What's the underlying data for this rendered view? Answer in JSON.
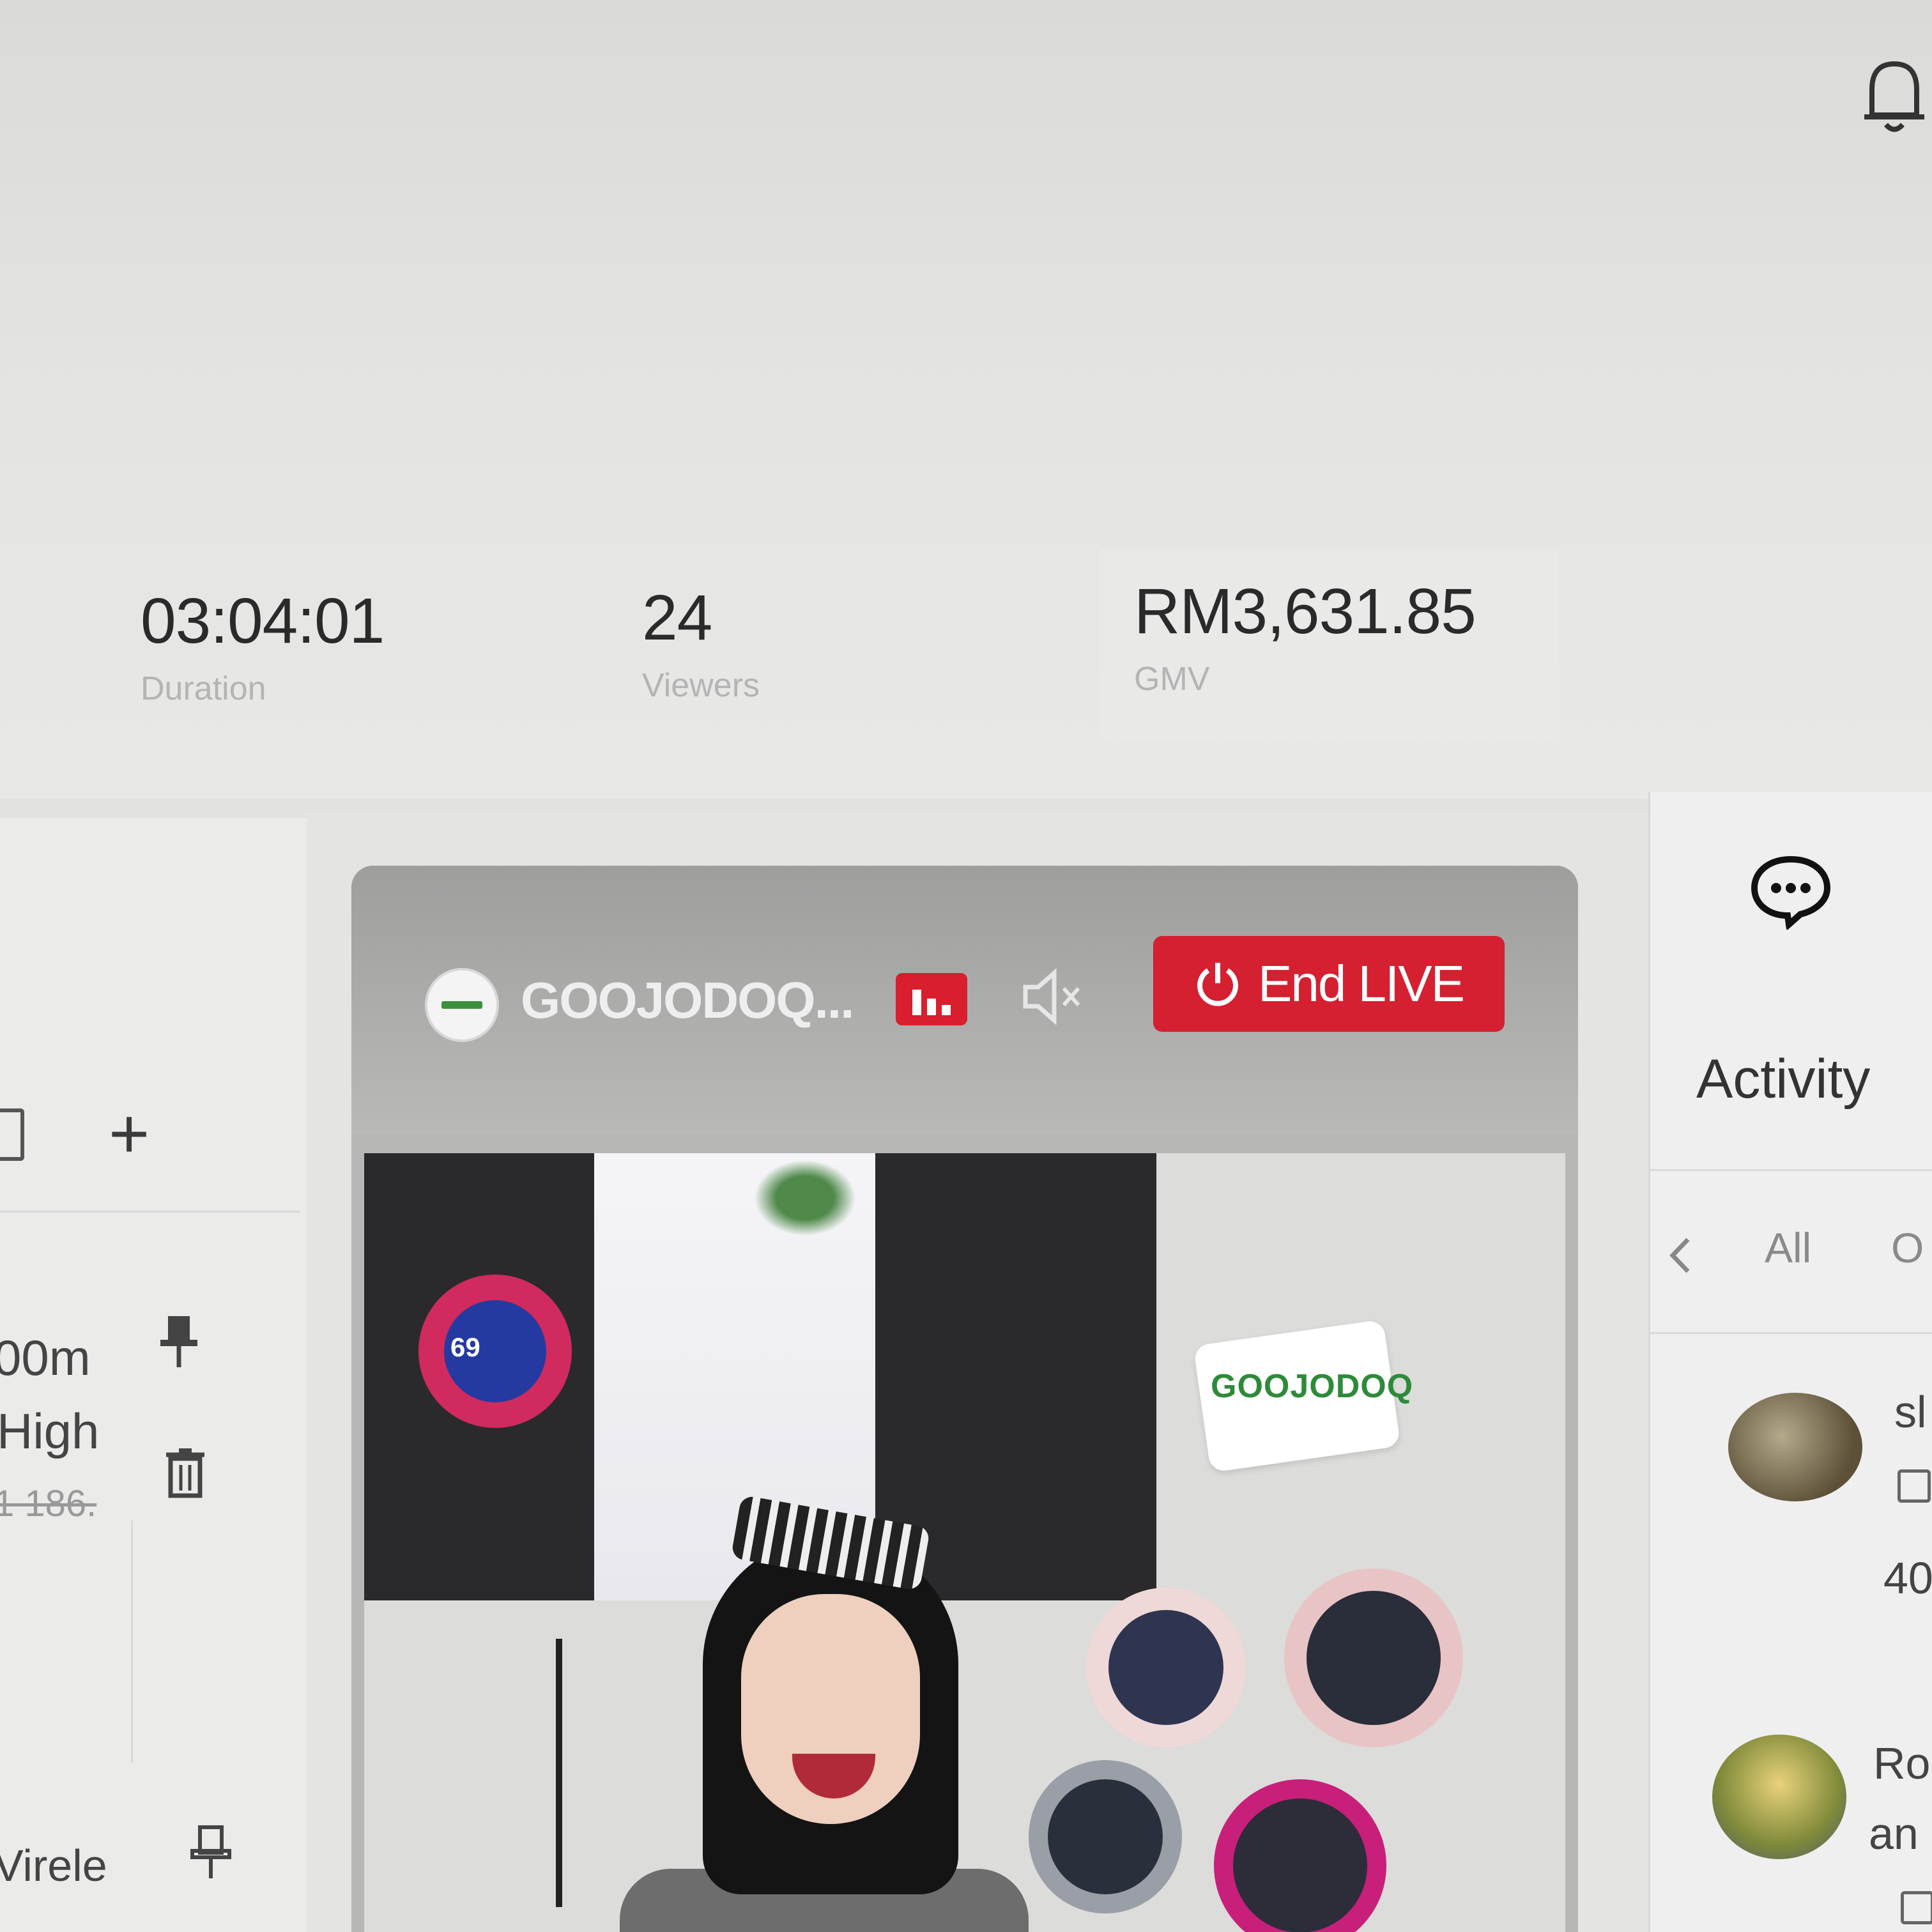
{
  "header": {
    "notifications_icon": "bell-icon"
  },
  "stats": {
    "duration": {
      "value": "03:04:01",
      "label": "Duration"
    },
    "viewers": {
      "value": "24",
      "label": "Viewers"
    },
    "gmv": {
      "value": "RM3,631.85",
      "label": "GMV"
    }
  },
  "live": {
    "host_name": "GOOJODOQ...",
    "stats_icon": "bar-chart-icon",
    "mute_icon": "speaker-muted-icon",
    "end_button_label": "End LIVE",
    "end_button_icon": "power-icon",
    "video": {
      "brand_logo_text": "GOOJODOQ",
      "dial_reading": "69"
    }
  },
  "products_panel": {
    "add_icon": "plus-icon",
    "items": [
      {
        "title_fragment": "00m",
        "subtitle_fragment": "High",
        "price_fragment": "1 186.",
        "pin_icon": "pin-filled-icon",
        "delete_icon": "trash-icon"
      },
      {
        "title_fragment": "Virele",
        "pin_icon": "pin-outline-icon"
      }
    ]
  },
  "activity_panel": {
    "chat_icon": "chat-bubble-icon",
    "title": "Activity",
    "tabs": [
      "All",
      "O"
    ],
    "entries": [
      {
        "name_fragment": "sl",
        "detail_fragment": "40"
      },
      {
        "name_fragment": "Ro",
        "detail_fragment": "an"
      }
    ]
  },
  "colors": {
    "accent_red": "#d42030",
    "text_dark": "#2a2a2a",
    "label_grey": "#b4b4b4"
  }
}
